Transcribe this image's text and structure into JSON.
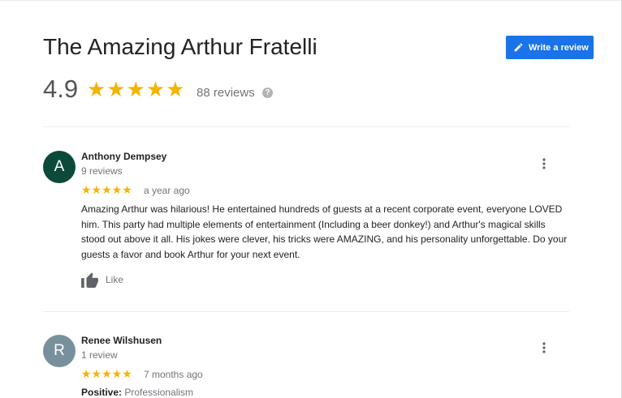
{
  "header": {
    "title": "The Amazing Arthur Fratelli",
    "write_review_label": "Write a review",
    "rating": "4.9",
    "stars": "★★★★★",
    "review_count": "88 reviews",
    "help_glyph": "?"
  },
  "reviews": [
    {
      "initial": "A",
      "avatar_color": "#0b4a3a",
      "name": "Anthony Dempsey",
      "meta": "9 reviews",
      "stars": "★★★★★",
      "rating": 5,
      "date": "a year ago",
      "text": "Amazing Arthur was hilarious! He entertained hundreds of guests at a recent corporate event, everyone LOVED him. This party had multiple elements of entertainment (Including a beer donkey!) and Arthur's magical skills stood out above it all. His jokes were clever, his tricks were AMAZING, and his personality unforgettable. Do your guests a favor and book Arthur for your next event.",
      "like_label": "Like"
    },
    {
      "initial": "R",
      "avatar_color": "#78909c",
      "name": "Renee Wilshusen",
      "meta": "1 review",
      "stars": "★★★★★",
      "rating": 5,
      "date": "7 months ago",
      "positive_label": "Positive:",
      "positive_value": "Professionalism"
    }
  ],
  "colors": {
    "accent": "#1a73e8",
    "star": "#f4b400"
  },
  "icons": [
    "pencil-icon",
    "help-icon",
    "more-vert-icon",
    "thumbs-up-icon"
  ]
}
